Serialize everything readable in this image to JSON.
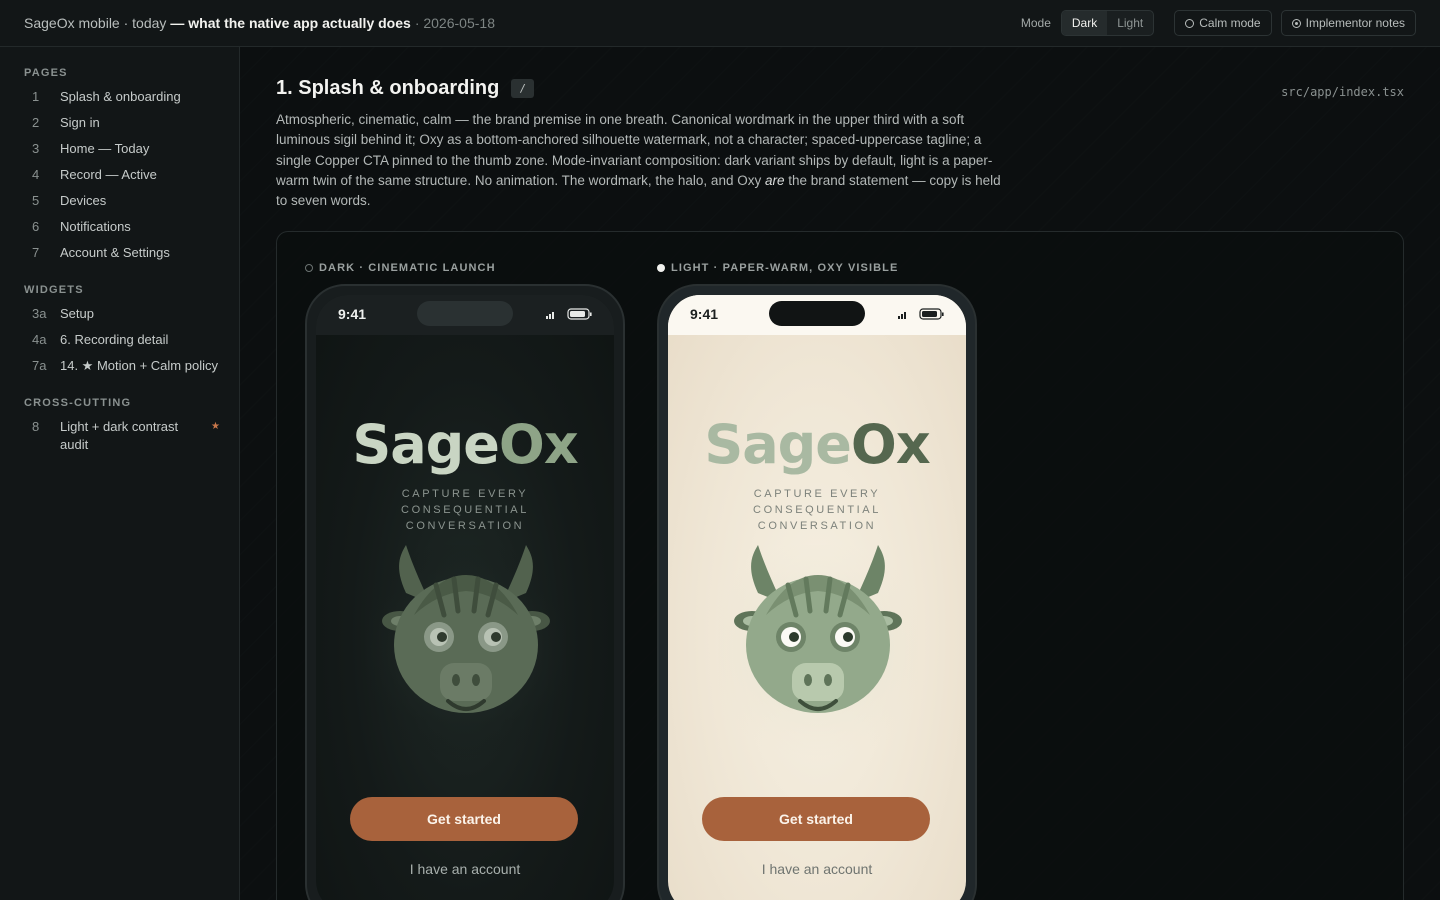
{
  "topbar": {
    "app": "SageOx mobile · today",
    "headline": "— what the native app actually does",
    "date": "· 2026-05-18",
    "mode_label": "Mode",
    "mode_options": [
      "Dark",
      "Light"
    ],
    "mode_selected": "Dark",
    "calm_mode": "Calm mode",
    "implementor_notes": "Implementor notes"
  },
  "sidebar": {
    "pages_title": "PAGES",
    "pages": [
      {
        "num": "1",
        "label": "Splash & onboarding"
      },
      {
        "num": "2",
        "label": "Sign in"
      },
      {
        "num": "3",
        "label": "Home — Today"
      },
      {
        "num": "4",
        "label": "Record — Active"
      },
      {
        "num": "5",
        "label": "Devices"
      },
      {
        "num": "6",
        "label": "Notifications"
      },
      {
        "num": "7",
        "label": "Account & Settings"
      }
    ],
    "widgets_title": "WIDGETS",
    "widgets": [
      {
        "num": "3a",
        "label": "Setup"
      },
      {
        "num": "4a",
        "label": "6. Recording detail"
      },
      {
        "num": "7a",
        "label": "14. ★ Motion + Calm policy"
      }
    ],
    "cross_title": "CROSS-CUTTING",
    "cross": [
      {
        "num": "8",
        "label": "Light + dark contrast audit",
        "star": "★"
      }
    ]
  },
  "main": {
    "title": "1. Splash & onboarding",
    "shortcut": "/",
    "src_path": "src/app/index.tsx",
    "desc_part1": "Atmospheric, cinematic, calm — the brand premise in one breath. Canonical wordmark in the upper third with a soft luminous sigil behind it; Oxy as a bottom-anchored silhouette watermark, not a character; spaced-uppercase tagline; a single Copper CTA pinned to the thumb zone. Mode-invariant composition: dark variant ships by default, light is a paper-warm twin of the same structure. No animation. The wordmark, the halo, and Oxy",
    "desc_em": "are",
    "desc_part2": "the brand statement — copy is held to seven words.",
    "variants": {
      "dark": {
        "label": "DARK · CINEMATIC LAUNCH",
        "time": "9:41",
        "wordmark_a": "Sage",
        "wordmark_b": "Ox",
        "tagline_1": "CAPTURE EVERY",
        "tagline_2": "CONSEQUENTIAL",
        "tagline_3": "CONVERSATION",
        "cta": "Get started",
        "alt": "I have an account"
      },
      "light": {
        "label": "LIGHT · PAPER-WARM, OXY VISIBLE",
        "time": "9:41",
        "wordmark_a": "Sage",
        "wordmark_b": "Ox",
        "tagline_1": "CAPTURE EVERY",
        "tagline_2": "CONSEQUENTIAL",
        "tagline_3": "CONVERSATION",
        "cta": "Get started",
        "alt": "I have an account"
      }
    }
  },
  "colors": {
    "copper": "#a8623c",
    "sage_dark": "#55674f",
    "sage_light": "#8ea487"
  }
}
